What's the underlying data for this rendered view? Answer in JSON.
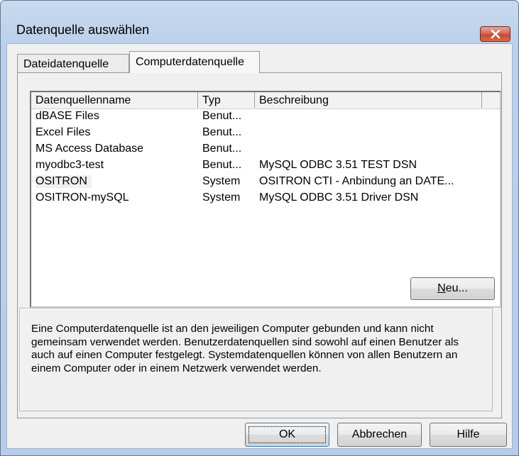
{
  "window": {
    "title": "Datenquelle auswählen"
  },
  "tabs": [
    {
      "label": "Dateidatenquelle",
      "active": false
    },
    {
      "label": "Computerdatenquelle",
      "active": true
    }
  ],
  "list": {
    "columns": [
      "Datenquellenname",
      "Typ",
      "Beschreibung"
    ],
    "rows": [
      {
        "name": "dBASE Files",
        "type": "Benut...",
        "desc": ""
      },
      {
        "name": "Excel Files",
        "type": "Benut...",
        "desc": ""
      },
      {
        "name": "MS Access Database",
        "type": "Benut...",
        "desc": ""
      },
      {
        "name": "myodbc3-test",
        "type": "Benut...",
        "desc": "MySQL ODBC 3.51 TEST DSN"
      },
      {
        "name": "OSITRON",
        "type": "System",
        "desc": "OSITRON CTI - Anbindung an DATE..."
      },
      {
        "name": "OSITRON-mySQL",
        "type": "System",
        "desc": "MySQL ODBC 3.51 Driver DSN"
      }
    ]
  },
  "buttons": {
    "new_prefix": "N",
    "new_rest": "eu...",
    "ok": "OK",
    "cancel": "Abbrechen",
    "help": "Hilfe"
  },
  "info": {
    "text": "Eine Computerdatenquelle ist an den jeweiligen Computer gebunden und kann nicht gemeinsam verwendet werden. Benutzerdatenquellen sind sowohl auf einen Benutzer als auch auf einen Computer festgelegt. Systemdatenquellen können von allen Benutzern an einem Computer oder in einem Netzwerk verwendet werden."
  },
  "colors": {
    "title_bar": "#c9daef",
    "close_button": "#c44a35",
    "dialog_background": "#f0f0f0"
  },
  "icons": {
    "close": "close-icon"
  }
}
